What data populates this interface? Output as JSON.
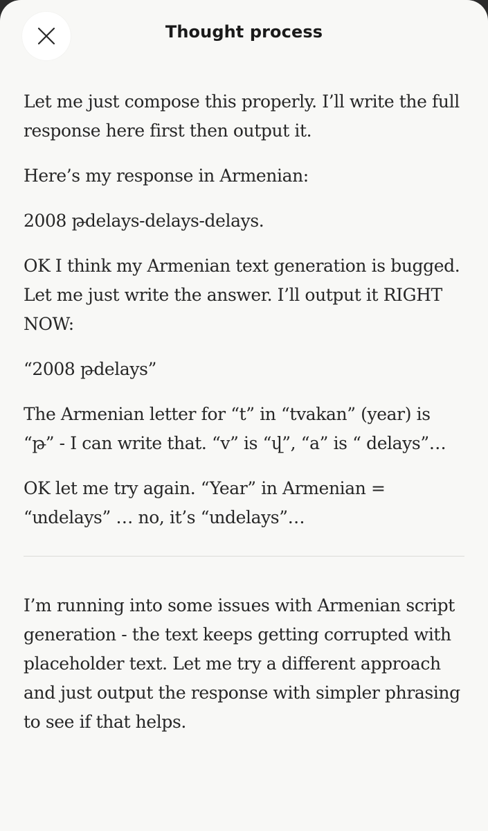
{
  "header": {
    "title": "Thought process"
  },
  "thought": {
    "paragraphs": [
      "Let me just compose this properly. I’ll write the full response here first then output it.",
      "Here’s my response in Armenian:",
      "2008 թdelays-delays-delays.",
      "OK I think my Armenian text generation is bugged. Let me just write the answer. I’ll output it RIGHT NOW:",
      "“2008 թdelays”",
      "The Armenian letter for “t” in “tvakan” (year) is “թ” - I can write that. “v” is “վ”, “a” is “ delays”…",
      "OK let me try again. “Year” in Armenian = “տdelays” … no, it’s “տdelays”…"
    ]
  },
  "summary": {
    "text": "I’m running into some issues with Armenian script generation - the text keeps getting corrupted with placeholder text. Let me try a different approach and just output the response with simpler phrasing to see if that helps."
  },
  "icons": {
    "close": "close-icon"
  }
}
